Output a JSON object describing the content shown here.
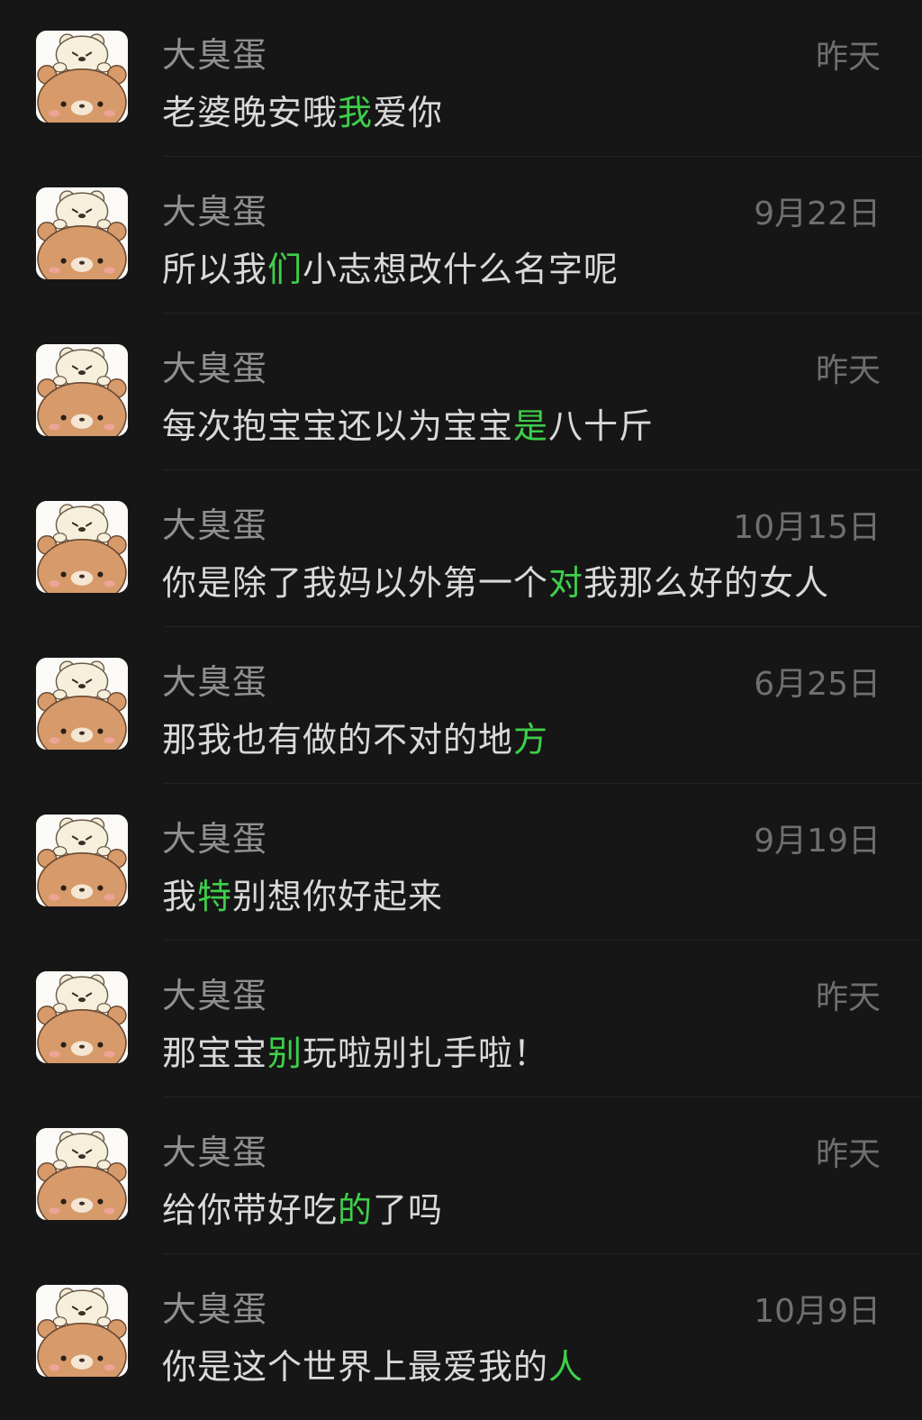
{
  "colors": {
    "background": "#161616",
    "name": "#8f8f8f",
    "time": "#6f6f6f",
    "message": "#d9d9d9",
    "highlight": "#3ecf4a"
  },
  "avatar_icon": "bear-sticker-avatar-icon",
  "conversations": [
    {
      "name": "大臭蛋",
      "time": "昨天",
      "message": {
        "before": "老婆晚安哦",
        "highlight": "我",
        "after": "爱你"
      }
    },
    {
      "name": "大臭蛋",
      "time": "9月22日",
      "message": {
        "before": "所以我",
        "highlight": "们",
        "after": "小志想改什么名字呢"
      }
    },
    {
      "name": "大臭蛋",
      "time": "昨天",
      "message": {
        "before": "每次抱宝宝还以为宝宝",
        "highlight": "是",
        "after": "八十斤"
      }
    },
    {
      "name": "大臭蛋",
      "time": "10月15日",
      "message": {
        "before": "你是除了我妈以外第一个",
        "highlight": "对",
        "after": "我那么好的女人"
      }
    },
    {
      "name": "大臭蛋",
      "time": "6月25日",
      "message": {
        "before": "那我也有做的不对的地",
        "highlight": "方",
        "after": ""
      }
    },
    {
      "name": "大臭蛋",
      "time": "9月19日",
      "message": {
        "before": "我",
        "highlight": "特",
        "after": "别想你好起来"
      }
    },
    {
      "name": "大臭蛋",
      "time": "昨天",
      "message": {
        "before": "那宝宝",
        "highlight": "别",
        "after": "玩啦别扎手啦！"
      }
    },
    {
      "name": "大臭蛋",
      "time": "昨天",
      "message": {
        "before": "给你带好吃",
        "highlight": "的",
        "after": "了吗"
      }
    },
    {
      "name": "大臭蛋",
      "time": "10月9日",
      "message": {
        "before": "你是这个世界上最爱我的",
        "highlight": "人",
        "after": ""
      }
    }
  ]
}
